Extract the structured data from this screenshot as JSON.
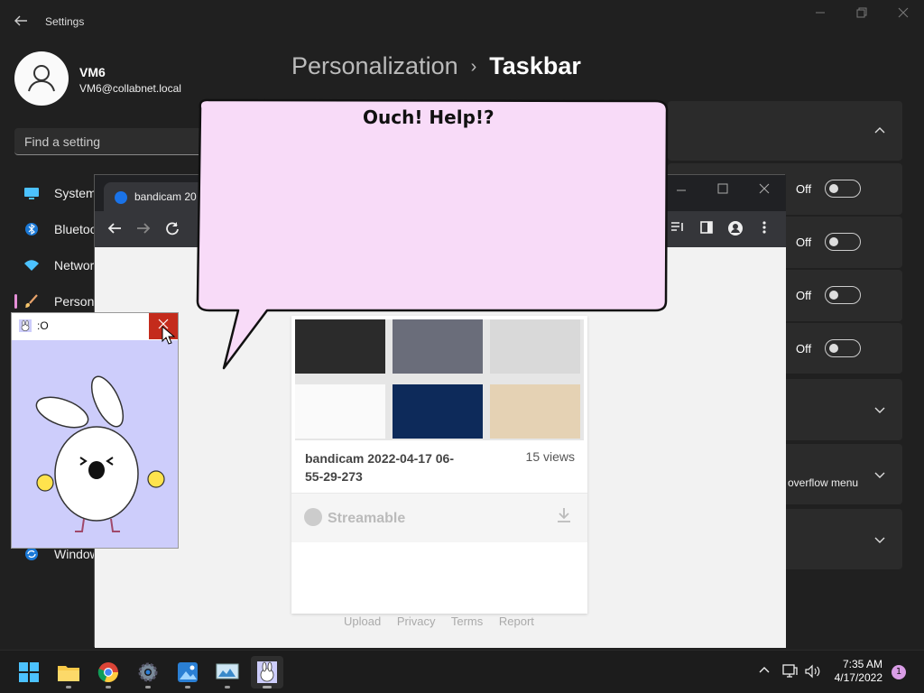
{
  "settings": {
    "app_title": "Settings",
    "user": {
      "name": "VM6",
      "email": "VM6@collabnet.local"
    },
    "search_placeholder": "Find a setting",
    "nav": [
      {
        "label": "System",
        "icon": "monitor-icon"
      },
      {
        "label": "Bluetoo",
        "icon": "bluetooth-icon"
      },
      {
        "label": "Networ",
        "icon": "wifi-icon"
      },
      {
        "label": "Persona",
        "icon": "brush-icon",
        "selected": true
      },
      {
        "label": "Window",
        "icon": "windows-update-icon"
      }
    ],
    "breadcrumb": {
      "parent": "Personalization",
      "separator": "›",
      "current": "Taskbar"
    },
    "toggles": [
      {
        "state": "Off"
      },
      {
        "state": "Off"
      },
      {
        "state": "Off"
      },
      {
        "state": "Off"
      }
    ],
    "overflow_label": "overflow menu"
  },
  "browser": {
    "tab_title": "bandicam 20",
    "video": {
      "title": "bandicam 2022-04-17 06-55-29-273",
      "views": "15 views",
      "brand": "Streamable"
    },
    "footer_links": [
      "Upload",
      "Privacy",
      "Terms",
      "Report"
    ]
  },
  "bubble": {
    "text": "Ouch! Help!?"
  },
  "face_window": {
    "title": ":O"
  },
  "taskbar": {
    "apps": [
      "start-icon",
      "file-explorer-icon",
      "chrome-icon",
      "settings-icon",
      "photos-icon",
      "monitor-app-icon",
      "bunny-app-icon"
    ],
    "time": "7:35 AM",
    "date": "4/17/2022",
    "notifications": "1"
  },
  "colors": {
    "accent_pink": "#e58fd7",
    "bubble_fill": "#f8dbf8",
    "face_bg": "#cdcdfb",
    "close_red": "#c42b1c"
  }
}
